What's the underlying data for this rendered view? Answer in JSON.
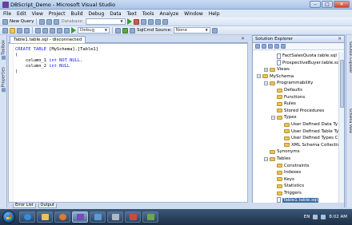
{
  "window": {
    "title": "DBScript_Demo - Microsoft Visual Studio"
  },
  "menu": [
    "File",
    "Edit",
    "View",
    "Project",
    "Build",
    "Debug",
    "Data",
    "Text",
    "Tools",
    "Analyze",
    "Window",
    "Help"
  ],
  "toolbar": {
    "new_query": "New Query",
    "database_label": "Database:",
    "config": "Debug",
    "sqlcmd_label": "SqlCmd Source:",
    "sqlcmd_value": "None"
  },
  "left_tabs": [
    "Toolbox",
    "Properties"
  ],
  "doc": {
    "tab_label": "Table1.table.sql - disconnected",
    "code_lines": [
      {
        "pre": "CREATE TABLE [MySchema].[Table1]",
        "type": "",
        "rest": ""
      },
      {
        "pre": "(",
        "type": "",
        "rest": ""
      },
      {
        "pre": "    column_1 ",
        "type": "int NOT NULL",
        "rest": ","
      },
      {
        "pre": "    column_2 ",
        "type": "int NULL",
        "rest": ""
      },
      {
        "pre": ")",
        "type": "",
        "rest": ""
      }
    ]
  },
  "solution_explorer": {
    "title": "Solution Explorer",
    "pin": "✕",
    "nodes": [
      {
        "depth": 3,
        "icon": "file",
        "label": "FactSalesQuota.table.sql",
        "toggle": ""
      },
      {
        "depth": 3,
        "icon": "file",
        "label": "ProspectiveBuyer.table.sq",
        "toggle": ""
      },
      {
        "depth": 2,
        "icon": "folder",
        "label": "Views",
        "toggle": "+"
      },
      {
        "depth": 1,
        "icon": "folder",
        "label": "MySchema",
        "toggle": "-"
      },
      {
        "depth": 2,
        "icon": "folder",
        "label": "Programmability",
        "toggle": "-"
      },
      {
        "depth": 3,
        "icon": "folder",
        "label": "Defaults",
        "toggle": ""
      },
      {
        "depth": 3,
        "icon": "folder",
        "label": "Functions",
        "toggle": ""
      },
      {
        "depth": 3,
        "icon": "folder",
        "label": "Rules",
        "toggle": ""
      },
      {
        "depth": 3,
        "icon": "folder",
        "label": "Stored Procedures",
        "toggle": ""
      },
      {
        "depth": 3,
        "icon": "folder",
        "label": "Types",
        "toggle": "-"
      },
      {
        "depth": 4,
        "icon": "folder",
        "label": "User Defined Data Ty",
        "toggle": ""
      },
      {
        "depth": 4,
        "icon": "folder",
        "label": "User Defined Table Ty",
        "toggle": ""
      },
      {
        "depth": 4,
        "icon": "folder",
        "label": "User Defined Types CL",
        "toggle": ""
      },
      {
        "depth": 4,
        "icon": "folder",
        "label": "XML Schema Collectio",
        "toggle": ""
      },
      {
        "depth": 2,
        "icon": "folder",
        "label": "Synonyms",
        "toggle": ""
      },
      {
        "depth": 2,
        "icon": "folder",
        "label": "Tables",
        "toggle": "-"
      },
      {
        "depth": 3,
        "icon": "folder",
        "label": "Constraints",
        "toggle": ""
      },
      {
        "depth": 3,
        "icon": "folder",
        "label": "Indexes",
        "toggle": ""
      },
      {
        "depth": 3,
        "icon": "folder",
        "label": "Keys",
        "toggle": ""
      },
      {
        "depth": 3,
        "icon": "folder",
        "label": "Statistics",
        "toggle": ""
      },
      {
        "depth": 3,
        "icon": "folder",
        "label": "Triggers",
        "toggle": ""
      },
      {
        "depth": 3,
        "icon": "file",
        "label": "Table1.table.sql",
        "toggle": "",
        "selected": true
      }
    ]
  },
  "right_tabs": [
    "Solution Explorer",
    "Schema View"
  ],
  "bottom_tabs": [
    "Error List",
    "Output"
  ],
  "tray": {
    "lang": "EN",
    "time": "8:02 AM"
  }
}
